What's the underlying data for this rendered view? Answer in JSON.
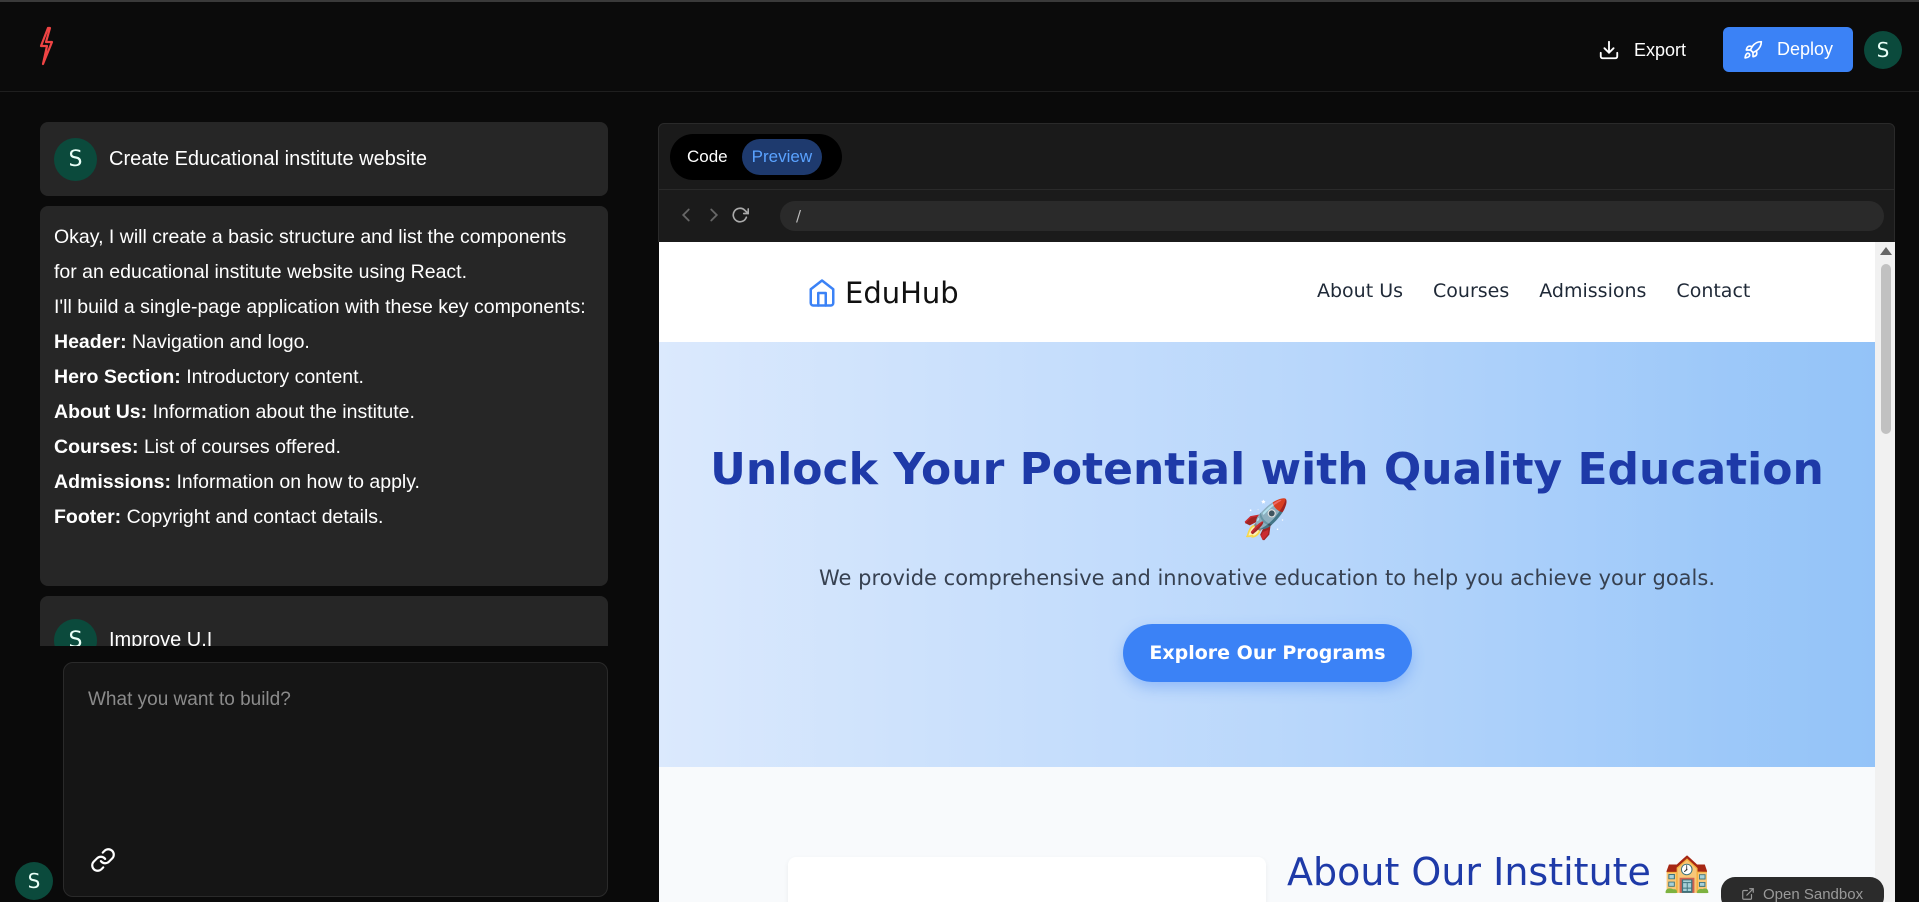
{
  "topbar": {
    "export_label": "Export",
    "deploy_label": "Deploy",
    "user_initial": "S"
  },
  "chat": {
    "messages": [
      {
        "role": "user",
        "initial": "S",
        "text": "Create Educational institute website"
      },
      {
        "role": "assistant",
        "intro_1": "Okay, I will create a basic structure and list the components for an educational institute website using React.",
        "intro_2": "I'll build a single-page application with these key components:",
        "items": [
          {
            "label": "Header:",
            "text": " Navigation and logo."
          },
          {
            "label": "Hero Section:",
            "text": " Introductory content."
          },
          {
            "label": "About Us:",
            "text": " Information about the institute."
          },
          {
            "label": "Courses:",
            "text": " List of courses offered."
          },
          {
            "label": "Admissions:",
            "text": " Information on how to apply."
          },
          {
            "label": "Footer:",
            "text": " Copyright and contact details."
          }
        ]
      },
      {
        "role": "user",
        "initial": "S",
        "text": "Improve U.I"
      }
    ],
    "input_placeholder": "What you want to build?",
    "sidebar_user_initial": "S"
  },
  "panel": {
    "tabs": {
      "code": "Code",
      "preview": "Preview"
    },
    "url": "/",
    "open_sandbox": "Open Sandbox"
  },
  "site": {
    "brand": "EduHub",
    "nav": [
      "About Us",
      "Courses",
      "Admissions",
      "Contact"
    ],
    "hero_title": "Unlock Your Potential with Quality Education",
    "hero_emoji": "🚀",
    "hero_subtitle": "We provide comprehensive and innovative education to help you achieve your goals.",
    "cta_label": "Explore Our Programs",
    "about_title": "About Our Institute 🏫"
  },
  "colors": {
    "accent": "#3b82f6",
    "hero_title": "#1e3aa8",
    "logo": "#ef4444",
    "avatar_bg": "#0b4a3c"
  }
}
